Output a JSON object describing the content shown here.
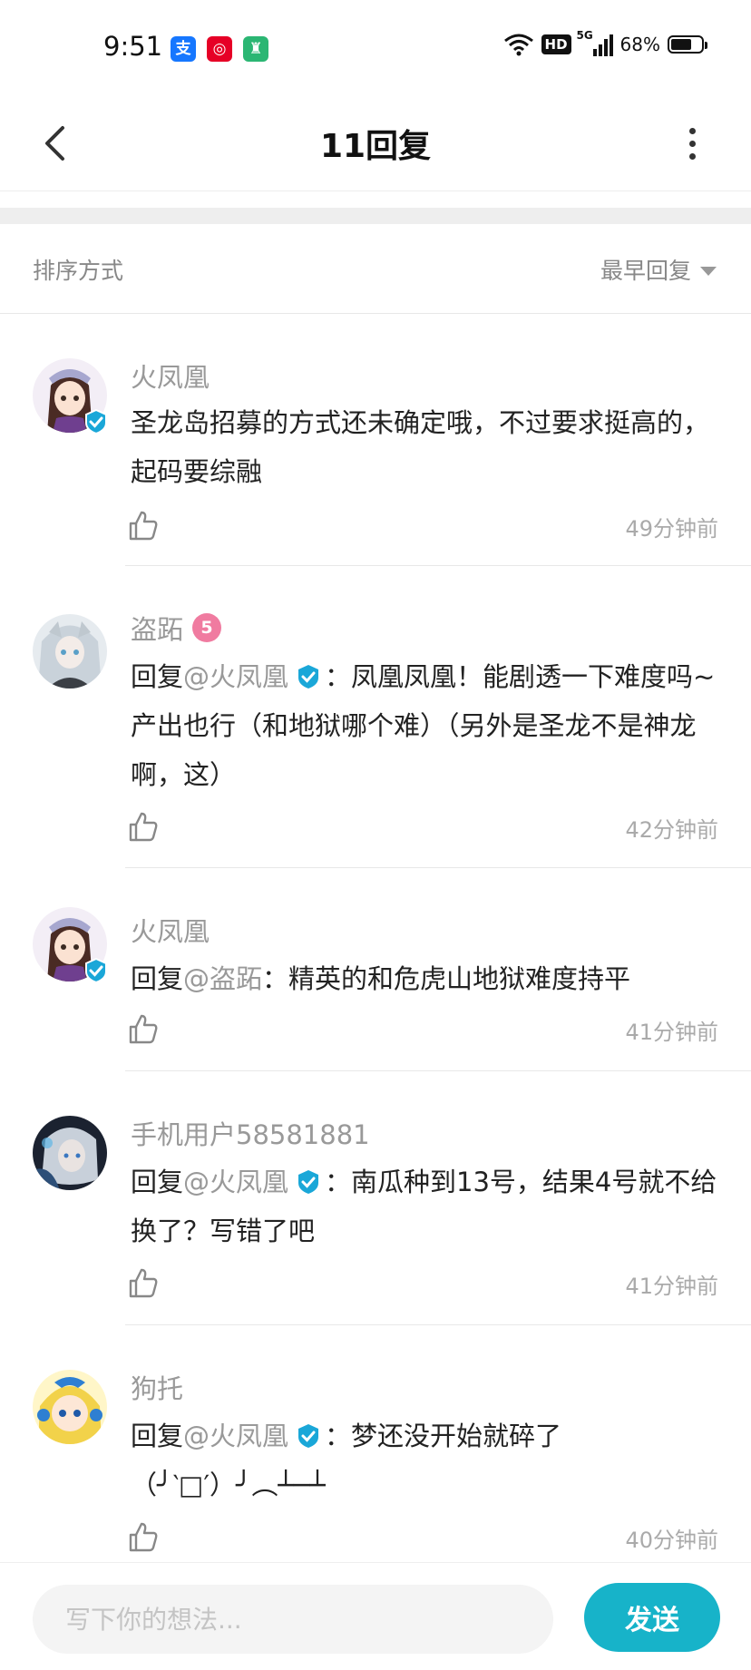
{
  "status_bar": {
    "time": "9:51",
    "app_icons": [
      {
        "name": "alipay-icon",
        "color": "#1677ff",
        "glyph": "支"
      },
      {
        "name": "netease-music-icon",
        "color": "#e60026",
        "glyph": "◎"
      },
      {
        "name": "green-app-icon",
        "color": "#2bb673",
        "glyph": "♜"
      }
    ],
    "hd": "HD",
    "network": "5G",
    "battery": "68%",
    "battery_level": 0.68
  },
  "header": {
    "title": "11回复"
  },
  "sort": {
    "label": "排序方式",
    "selected": "最早回复"
  },
  "colors": {
    "accent": "#17b3c9",
    "verified": "#1aa7d8",
    "level_badge": "#f07ba0"
  },
  "comments": [
    {
      "name": "火凤凰",
      "verified": true,
      "reply_prefix": "",
      "mention": "",
      "text": "圣龙岛招募的方式还未确定哦，不过要求挺高的，起码要综融",
      "time": "49分钟前"
    },
    {
      "name": "盗跖",
      "level": "5",
      "reply_prefix": "回复",
      "mention": "@火凤凰",
      "mention_verified": true,
      "text": "：凤凰凤凰！能剧透一下难度吗~产出也行（和地狱哪个难）（另外是圣龙不是神龙啊，这）",
      "time": "42分钟前"
    },
    {
      "name": "火凤凰",
      "verified": true,
      "reply_prefix": "回复",
      "mention": "@盗跖",
      "text": "：精英的和危虎山地狱难度持平",
      "time": "41分钟前"
    },
    {
      "name": "手机用户58581881",
      "reply_prefix": "回复",
      "mention": "@火凤凰",
      "mention_verified": true,
      "text": "：南瓜种到13号，结果4号就不给换了？写错了吧",
      "time": "41分钟前"
    },
    {
      "name": "狗托",
      "reply_prefix": "回复",
      "mention": "@火凤凰",
      "mention_verified": true,
      "text": "：梦还没开始就碎了",
      "text_line2": "（╯‵□′）╯︵┴─┴",
      "time": "40分钟前"
    }
  ],
  "composer": {
    "placeholder": "写下你的想法...",
    "send_label": "发送"
  }
}
